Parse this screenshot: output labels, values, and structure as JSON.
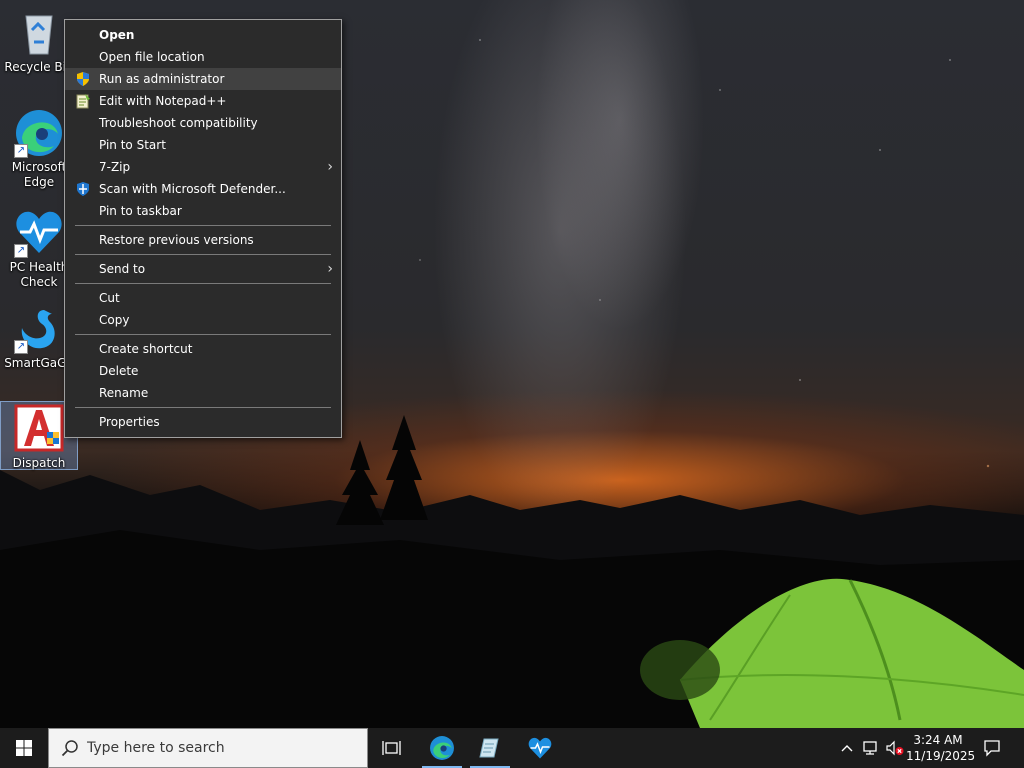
{
  "desktop": {
    "icons": [
      {
        "label": "Recycle Bin"
      },
      {
        "label": "Microsoft Edge"
      },
      {
        "label": "PC Health Check"
      },
      {
        "label": "SmartGaGa"
      },
      {
        "label": "Dispatch"
      }
    ]
  },
  "context_menu": {
    "items": [
      {
        "label": "Open",
        "bold": true
      },
      {
        "label": "Open file location"
      },
      {
        "label": "Run as administrator",
        "icon": "uac-shield-icon",
        "hovered": true
      },
      {
        "label": "Edit with Notepad++",
        "icon": "notepad-plus-plus-icon"
      },
      {
        "label": "Troubleshoot compatibility"
      },
      {
        "label": "Pin to Start"
      },
      {
        "label": "7-Zip",
        "submenu": true
      },
      {
        "label": "Scan with Microsoft Defender...",
        "icon": "defender-shield-icon"
      },
      {
        "label": "Pin to taskbar"
      },
      {
        "label": "Restore previous versions"
      },
      {
        "label": "Send to",
        "submenu": true
      },
      {
        "label": "Cut"
      },
      {
        "label": "Copy"
      },
      {
        "label": "Create shortcut"
      },
      {
        "label": "Delete"
      },
      {
        "label": "Rename"
      },
      {
        "label": "Properties"
      }
    ]
  },
  "taskbar": {
    "search_placeholder": "Type here to search",
    "clock": {
      "time": "3:24 AM",
      "date": "11/19/2025"
    },
    "apps": [
      "task-view-icon",
      "edge-icon",
      "notes-icon",
      "pc-health-icon"
    ],
    "tray": [
      "chevron-up-icon",
      "network-icon",
      "volume-muted-icon",
      "notification-icon"
    ]
  },
  "colors": {
    "menu_bg": "#2b2b2b",
    "menu_hover": "#414141",
    "taskbar_bg": "#1c1c1c",
    "accent": "#0078d7"
  }
}
